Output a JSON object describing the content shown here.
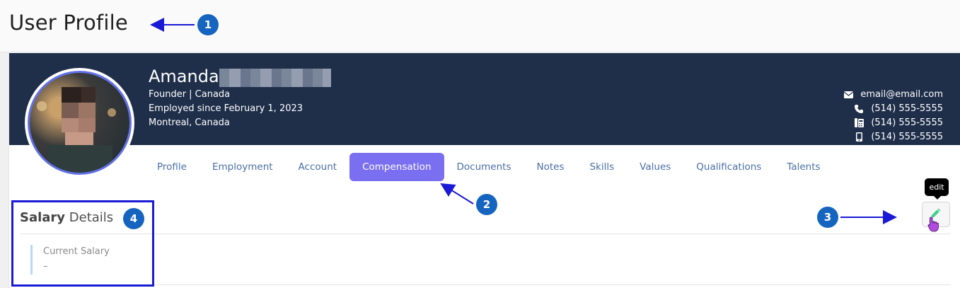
{
  "page": {
    "title": "User Profile"
  },
  "profile": {
    "first_name": "Amanda",
    "role_location": "Founder | Canada",
    "employed_since": "Employed since February 1, 2023",
    "city": "Montreal, Canada",
    "contacts": [
      {
        "icon": "envelope-icon",
        "value": "email@email.com"
      },
      {
        "icon": "phone-icon",
        "value": "(514) 555-5555"
      },
      {
        "icon": "fax-icon",
        "value": "(514) 555-5555"
      },
      {
        "icon": "mobile-icon",
        "value": "(514) 555-5555"
      }
    ]
  },
  "tabs": [
    {
      "label": "Profile",
      "active": false
    },
    {
      "label": "Employment",
      "active": false
    },
    {
      "label": "Account",
      "active": false
    },
    {
      "label": "Compensation",
      "active": true
    },
    {
      "label": "Documents",
      "active": false
    },
    {
      "label": "Notes",
      "active": false
    },
    {
      "label": "Skills",
      "active": false
    },
    {
      "label": "Values",
      "active": false
    },
    {
      "label": "Qualifications",
      "active": false
    },
    {
      "label": "Talents",
      "active": false
    }
  ],
  "salary": {
    "title_bold": "Salary",
    "title_rest": " Details",
    "field_label": "Current Salary",
    "field_value": "–"
  },
  "edit": {
    "tooltip": "edit"
  },
  "callouts": [
    "1",
    "2",
    "3",
    "4"
  ],
  "colors": {
    "banner": "#1f2f4a",
    "active_tab": "#7a6ff0",
    "tab_text": "#4a6fa5",
    "callout": "#1565c0",
    "edit_icon": "#3ecf8e"
  }
}
